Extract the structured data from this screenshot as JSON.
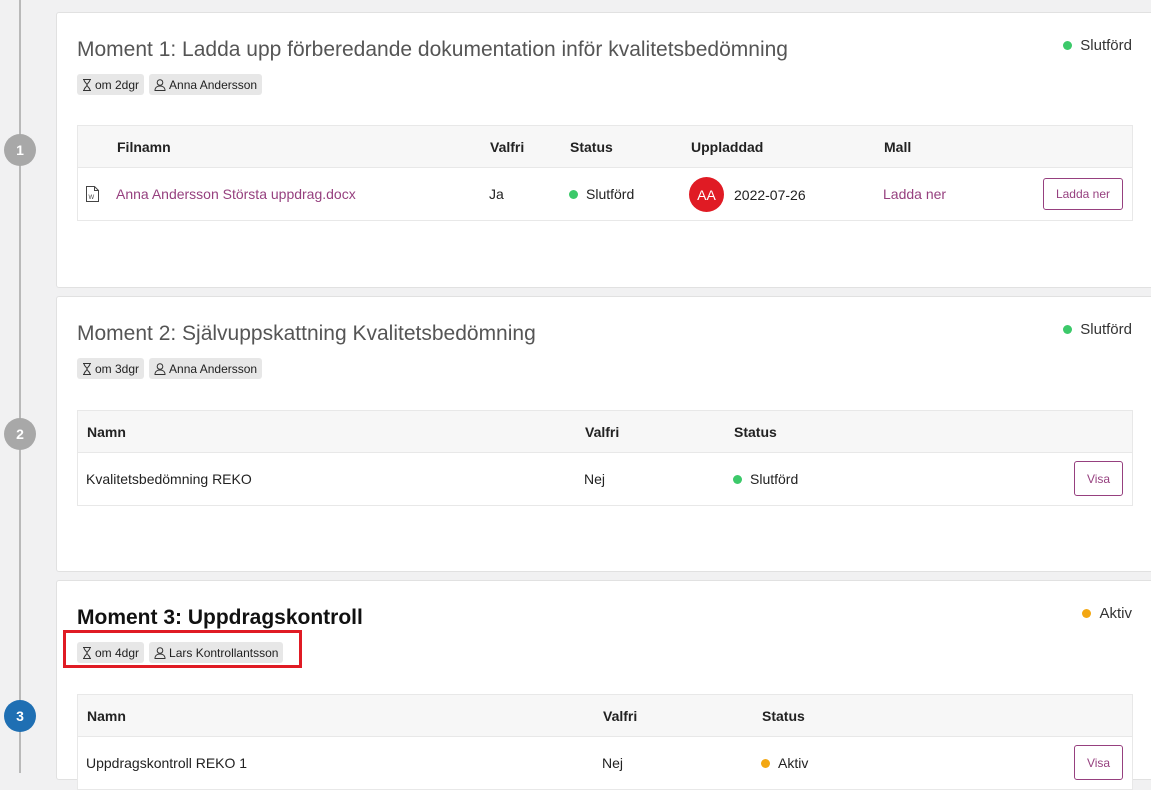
{
  "moments": [
    {
      "step": "1",
      "title": "Moment 1: Ladda upp förberedande dokumentation inför kvalitetsbedömning",
      "status": "Slutförd",
      "badges": {
        "due": "om 2dgr",
        "assignee": "Anna Andersson"
      },
      "table": {
        "headers": [
          "Filnamn",
          "Valfri",
          "Status",
          "Uppladdad",
          "Mall"
        ],
        "rows": [
          {
            "name": "Anna Andersson Största uppdrag.docx",
            "optional": "Ja",
            "status": "Slutförd",
            "avatar": "AA",
            "uploaded": "2022-07-26",
            "template": "Ladda ner",
            "button": "Ladda ner"
          }
        ]
      }
    },
    {
      "step": "2",
      "title": "Moment 2: Självuppskattning Kvalitetsbedömning",
      "status": "Slutförd",
      "badges": {
        "due": "om 3dgr",
        "assignee": "Anna Andersson"
      },
      "table": {
        "headers": [
          "Namn",
          "Valfri",
          "Status"
        ],
        "rows": [
          {
            "name": "Kvalitetsbedömning REKO",
            "optional": "Nej",
            "status": "Slutförd",
            "button": "Visa"
          }
        ]
      }
    },
    {
      "step": "3",
      "title": "Moment 3: Uppdragskontroll",
      "status": "Aktiv",
      "badges": {
        "due": "om 4dgr",
        "assignee": "Lars Kontrollantsson"
      },
      "table": {
        "headers": [
          "Namn",
          "Valfri",
          "Status"
        ],
        "rows": [
          {
            "name": "Uppdragskontroll REKO 1",
            "optional": "Nej",
            "status": "Aktiv",
            "button": "Visa"
          }
        ]
      }
    }
  ],
  "colors": {
    "accent": "#96407f",
    "done": "#3cc96a",
    "active": "#f3a712",
    "step_active": "#1f6fb3",
    "highlight": "#e01b24"
  },
  "icons": {
    "due": "hourglass-icon",
    "assignee": "person-icon",
    "file": "word-document-icon"
  }
}
